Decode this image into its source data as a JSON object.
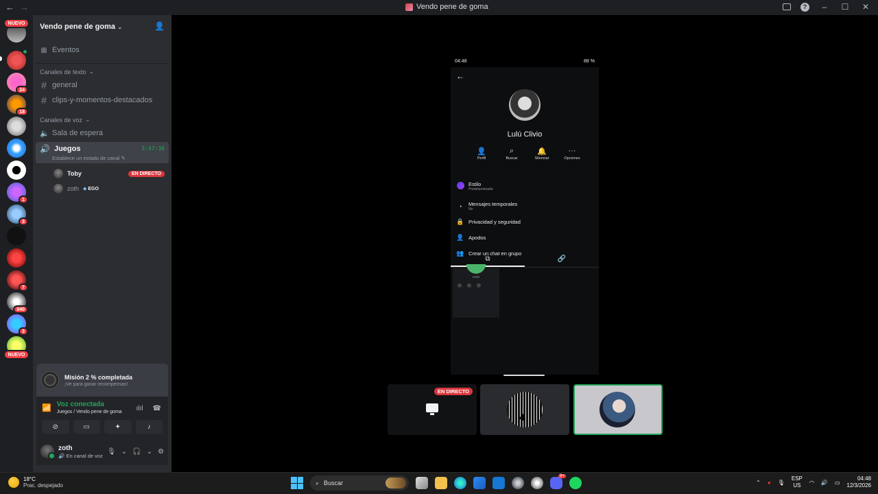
{
  "window": {
    "title": "Vendo pene de goma"
  },
  "server_rail": {
    "new_label_top": "NUEVO",
    "new_label_bottom": "NUEVO",
    "badges": [
      "24",
      "18",
      "1",
      "3",
      "7",
      "840",
      "3"
    ]
  },
  "sidebar": {
    "guild_name": "Vendo pene de goma",
    "events_label": "Eventos",
    "text_category": "Canales de texto",
    "text_channels": [
      "general",
      "clips-y-momentos-destacados"
    ],
    "voice_category": "Canales de voz",
    "waiting_room": "Sala de espera",
    "active_voice": {
      "name": "Juegos",
      "timer": "3:47:36",
      "status_placeholder": "Establece un estado de canal"
    },
    "voice_users": [
      {
        "name": "Toby",
        "badge": "EN DIRECTO"
      },
      {
        "name": "zoth",
        "tag": "EGO"
      }
    ]
  },
  "mission": {
    "title": "Misión 2 % completada",
    "subtitle": "¡Ve para ganar recompensas!"
  },
  "voice_panel": {
    "status": "Voz conectada",
    "location": "Juegos / Vendo pene de goma"
  },
  "user_panel": {
    "username": "zoth",
    "status": "En canal de voz"
  },
  "phone": {
    "time": "04:48",
    "battery": "88 %",
    "profile_name": "Lulú Clivio",
    "actions": [
      "Perfil",
      "Buscar",
      "Silenciar",
      "Opciones"
    ],
    "menu": [
      {
        "title": "Estilo",
        "sub": "Predeterminado"
      },
      {
        "title": "Mensajes temporales",
        "sub": "No"
      },
      {
        "title": "Privacidad y seguridad",
        "sub": ""
      },
      {
        "title": "Apodos",
        "sub": ""
      },
      {
        "title": "Crear un chat en grupo",
        "sub": ""
      }
    ],
    "thumb_name": "Leon"
  },
  "tiles": {
    "live_label": "EN DIRECTO",
    "tile2_number": "4"
  },
  "taskbar": {
    "weather_temp": "18°C",
    "weather_desc": "Prac. despejado",
    "search_placeholder": "Buscar",
    "discord_badge": "9+",
    "lang": "ESP",
    "region": "US",
    "time": "04:48",
    "date": "12/3/2026"
  }
}
